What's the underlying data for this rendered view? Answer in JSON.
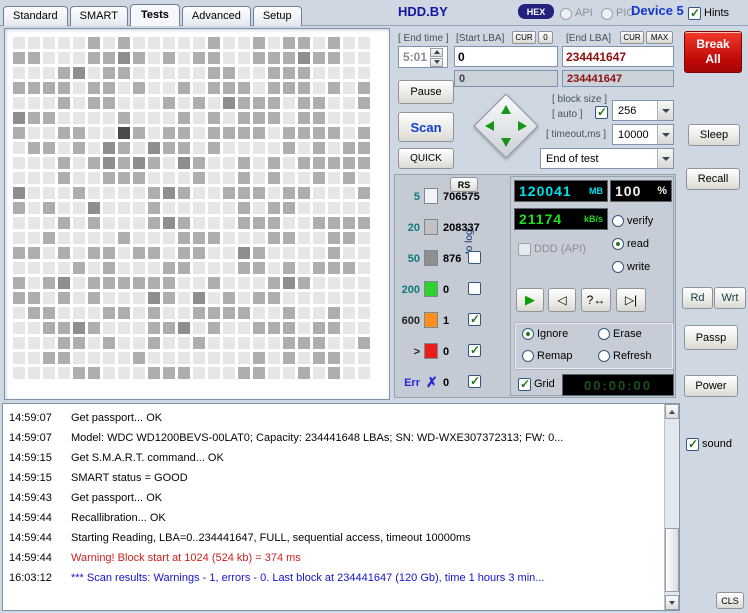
{
  "colors": {
    "background": "#cfd8e2",
    "panel_gray": "#c5cbd4",
    "accent_blue": "#1536cc",
    "title_blue": "#14149e",
    "display_cyan": "#00e0e6",
    "display_green": "#1ddf1d",
    "display_white": "#f2f2f2",
    "value_dark_red": "#8c1010",
    "warning_red": "#d02020",
    "result_blue": "#1414cc",
    "teal_label": "#0e7a7a",
    "err_blue": "#2828d8"
  },
  "tabs": [
    {
      "label": "Standard"
    },
    {
      "label": "SMART"
    },
    {
      "label": "Tests"
    },
    {
      "label": "Advanced"
    },
    {
      "label": "Setup"
    }
  ],
  "header": {
    "title": "HDD.BY",
    "hex": "HEX",
    "api": "API",
    "pio": "PIO",
    "device": "Device 5",
    "hints": "Hints",
    "hints_checked": true
  },
  "scan_map": {
    "cols": 24,
    "rows": 23
  },
  "test_controls": {
    "end_time_label": "[ End time ]",
    "end_time_value": "5:01",
    "start_lba_label": "[Start LBA]",
    "cur": "CUR",
    "zero": "0",
    "end_lba_label": "[End LBA]",
    "max": "MAX",
    "start_lba_value": "0",
    "end_lba_value": "234441647",
    "start_lba_current": "0",
    "end_lba_current": "234441647",
    "pause": "Pause",
    "scan": "Scan",
    "quick": "QUICK",
    "block_size_label": "[ block size ]",
    "auto_label": "[ auto ]",
    "auto_checked": true,
    "block_size_value": "256",
    "timeout_label": "[ timeout,ms ]",
    "timeout_value": "10000",
    "end_action_value": "End of test",
    "rs": "RS",
    "to_log": "to log:"
  },
  "histogram": [
    {
      "label": "5",
      "count": "706575",
      "block_color": "#f4f4f4"
    },
    {
      "label": "20",
      "count": "208337",
      "block_color": "#c2c2c2"
    },
    {
      "label": "50",
      "count": "876",
      "block_color": "#8f8f8f",
      "log_checked": false
    },
    {
      "label": "200",
      "count": "0",
      "block_color": "#2ed12e",
      "log_checked": false
    },
    {
      "label": "600",
      "count": "1",
      "block_color": "#ff9020",
      "log_checked": true
    },
    {
      "label": ">",
      "count": "0",
      "block_color": "#ea1c1c",
      "log_checked": true
    },
    {
      "label": "Err",
      "count": "0",
      "glyph": "✗",
      "log_checked": true
    }
  ],
  "status": {
    "mb_value": "120041",
    "mb_unit": "MB",
    "percent_value": "100",
    "percent_unit": "%",
    "speed_value": "21174",
    "speed_unit": "kB/s",
    "ddd_label": "DDD (API)",
    "ddd_checked": false,
    "modes": [
      {
        "label": "verify"
      },
      {
        "label": "read"
      },
      {
        "label": "write"
      }
    ],
    "mode_selected": "read",
    "actions": [
      {
        "label": "Ignore"
      },
      {
        "label": "Erase"
      },
      {
        "label": "Remap"
      },
      {
        "label": "Refresh"
      }
    ],
    "action_selected": "Ignore",
    "grid_label": "Grid",
    "grid_checked": true,
    "timer": "00:00:00"
  },
  "transport": {
    "play_icon": "▶",
    "back_icon": "◁",
    "random_icon": "?↔",
    "end_icon": "▷|"
  },
  "side": {
    "break_line1": "Break",
    "break_line2": "All",
    "sleep": "Sleep",
    "recall": "Recall",
    "rd": "Rd",
    "wrt": "Wrt",
    "passp": "Passp",
    "power": "Power",
    "sound": "sound",
    "sound_checked": true,
    "cls": "CLS"
  },
  "log": {
    "lines": [
      {
        "time": "14:59:07",
        "text": "Get passport... OK",
        "color": "normal"
      },
      {
        "time": "14:59:07",
        "text": "Model: WDC WD1200BEVS-00LAT0; Capacity: 234441648 LBAs; SN: WD-WXE307372313; FW: 0...",
        "color": "normal"
      },
      {
        "time": "14:59:15",
        "text": "Get S.M.A.R.T. command... OK",
        "color": "normal"
      },
      {
        "time": "14:59:15",
        "text": "SMART status = GOOD",
        "color": "normal"
      },
      {
        "time": "14:59:43",
        "text": "Get passport... OK",
        "color": "normal"
      },
      {
        "time": "14:59:44",
        "text": "Recallibration... OK",
        "color": "normal"
      },
      {
        "time": "14:59:44",
        "text": "Starting Reading, LBA=0..234441647, FULL, sequential access, timeout 10000ms",
        "color": "normal"
      },
      {
        "time": "14:59:44",
        "text": "Warning! Block start at 1024 (524 kb)  = 374 ms",
        "color": "warning"
      },
      {
        "time": "16:03:12",
        "text": "*** Scan results: Warnings - 1, errors - 0. Last block at 234441647 (120 Gb), time 1 hours 3 min...",
        "color": "result"
      }
    ]
  }
}
